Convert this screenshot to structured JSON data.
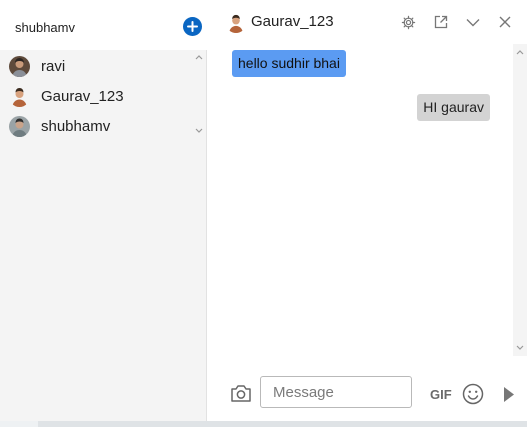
{
  "sidebar": {
    "title": "shubhamv",
    "add_icon": "plus-circle-icon",
    "contacts": [
      {
        "label": "ravi",
        "avatar_color": "#6b5b4f"
      },
      {
        "label": "Gaurav_123",
        "avatar_color": "#b5643a"
      },
      {
        "label": "shubhamv",
        "avatar_color": "#7b8a8f"
      }
    ]
  },
  "chat": {
    "contact_name": "Gaurav_123",
    "header_icons": [
      "gear-icon",
      "pop-out-icon",
      "chevron-down-icon",
      "close-icon"
    ],
    "messages": [
      {
        "direction": "incoming",
        "text": "hello sudhir bhai",
        "color": "#5b9bf2"
      },
      {
        "direction": "outgoing",
        "text": "HI gaurav",
        "color": "#d3d3d3"
      }
    ]
  },
  "composer": {
    "placeholder": "Message",
    "gif_label": "GIF",
    "icons": [
      "camera-icon",
      "emoji-icon",
      "send-icon"
    ]
  },
  "colors": {
    "accent": "#0a66c2",
    "sidebar_bg": "#f4f4f4"
  }
}
